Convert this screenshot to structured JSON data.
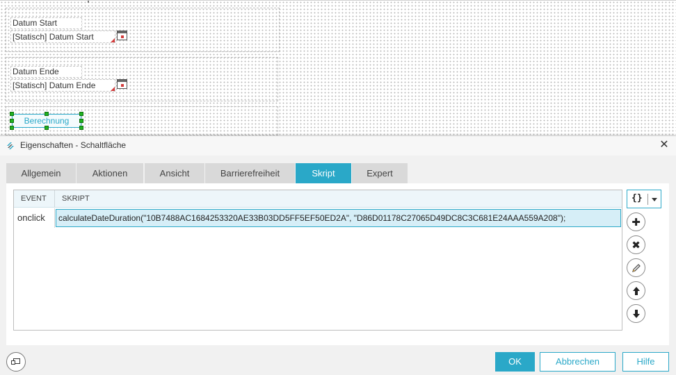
{
  "canvas": {
    "fields": [
      {
        "label": "Datum Start",
        "value": "[Statisch] Datum Start"
      },
      {
        "label": "Datum Ende",
        "value": "[Statisch] Datum Ende"
      }
    ],
    "button_label": "Berechnung"
  },
  "dialog": {
    "title": "Eigenschaften - Schaltfläche",
    "tabs": [
      "Allgemein",
      "Aktionen",
      "Ansicht",
      "Barrierefreiheit",
      "Skript",
      "Expert"
    ],
    "active_tab": "Skript",
    "grid": {
      "columns": [
        "EVENT",
        "SKRIPT"
      ],
      "rows": [
        {
          "event": "onclick",
          "script": "calculateDateDuration(\"10B7488AC1684253320AE33B03DD5FF5EF50ED2A\", \"D86D01178C27065D49DC8C3C681E24AAA559A208\");"
        }
      ]
    },
    "tools": {
      "dropdown_glyph": "{}",
      "icons": [
        "add-icon",
        "delete-icon",
        "edit-icon",
        "move-up-icon",
        "move-down-icon"
      ]
    },
    "footer": {
      "ok": "OK",
      "cancel": "Abbrechen",
      "help": "Hilfe"
    }
  },
  "colors": {
    "accent": "#2aa8c8",
    "selection_handle": "#1fb31f",
    "marker_red": "#d23b3b"
  }
}
